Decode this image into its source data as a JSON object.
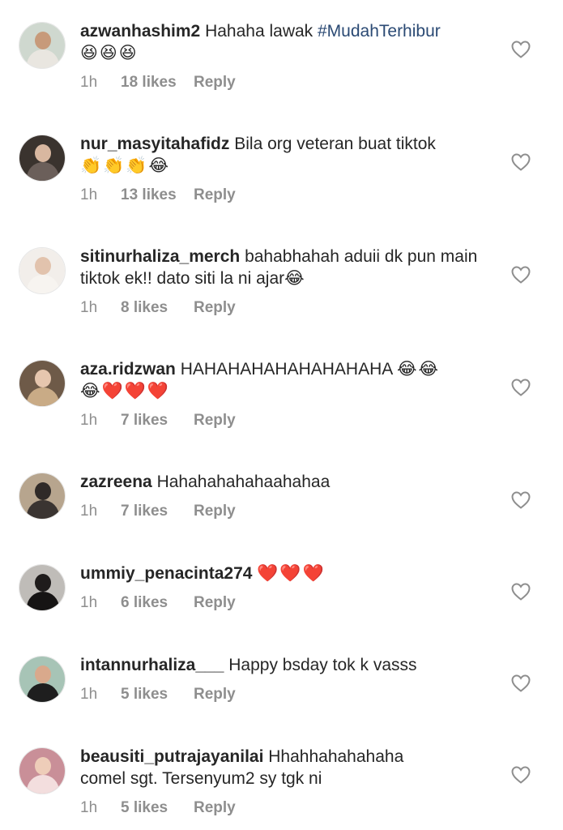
{
  "comments": [
    {
      "username": "azwanhashim2",
      "text": "Hahaha lawak ",
      "hashtag": "#MudahTerhibur",
      "emojis": "😆😆😆",
      "time": "1h",
      "likes": "18 likes",
      "reply": "Reply",
      "avatar_colors": {
        "bg": "#cfd8cf",
        "head": "#c79a7a",
        "body": "#e9e6e0"
      }
    },
    {
      "username": "nur_masyitahafidz",
      "text": "Bila org veteran buat tiktok",
      "emojis": "👏👏👏😂",
      "time": "1h",
      "likes": "13 likes",
      "reply": "Reply",
      "avatar_colors": {
        "bg": "#3a332e",
        "head": "#d8b7a0",
        "body": "#6b5f5a"
      }
    },
    {
      "username": "sitinurhaliza_merch",
      "text": "bahabhahah aduii dk pun main tiktok ek!! dato siti la ni ajar",
      "emojis": "😂",
      "time": "1h",
      "likes": "8 likes",
      "reply": "Reply",
      "avatar_colors": {
        "bg": "#f2eeea",
        "head": "#e2c3ad",
        "body": "#f7f4f0"
      }
    },
    {
      "username": "aza.ridzwan",
      "text": "HAHAHAHAHAHAHAHAHA ",
      "emojis": "😂😂",
      "emojis2": "😂❤️❤️❤️",
      "time": "1h",
      "likes": "7 likes",
      "reply": "Reply",
      "avatar_colors": {
        "bg": "#6e5a48",
        "head": "#e6c6ae",
        "body": "#c9ab86"
      }
    },
    {
      "username": "zazreena",
      "text": "Hahahahahahaahahaa",
      "time": "1h",
      "likes": "7 likes",
      "reply": "Reply",
      "avatar_colors": {
        "bg": "#b7a58e",
        "head": "#2f2a28",
        "body": "#3a3431"
      }
    },
    {
      "username": "ummiy_penacinta274",
      "emojis": "❤️❤️❤️",
      "time": "1h",
      "likes": "6 likes",
      "reply": "Reply",
      "avatar_colors": {
        "bg": "#bfbcb8",
        "head": "#1f1c1c",
        "body": "#161414"
      }
    },
    {
      "username": "intannurhaliza___",
      "text": "Happy bsday tok k vasss",
      "time": "1h",
      "likes": "5 likes",
      "reply": "Reply",
      "avatar_colors": {
        "bg": "#a7c4b6",
        "head": "#d9a98c",
        "body": "#1e1e1e"
      }
    },
    {
      "username": "beausiti_putrajayanilai",
      "text": "Hhahhahahahaha comel sgt. Tersenyum2 sy tgk ni",
      "time": "1h",
      "likes": "5 likes",
      "reply": "Reply",
      "avatar_colors": {
        "bg": "#c98f98",
        "head": "#eecdb9",
        "body": "#f3dede"
      }
    }
  ]
}
